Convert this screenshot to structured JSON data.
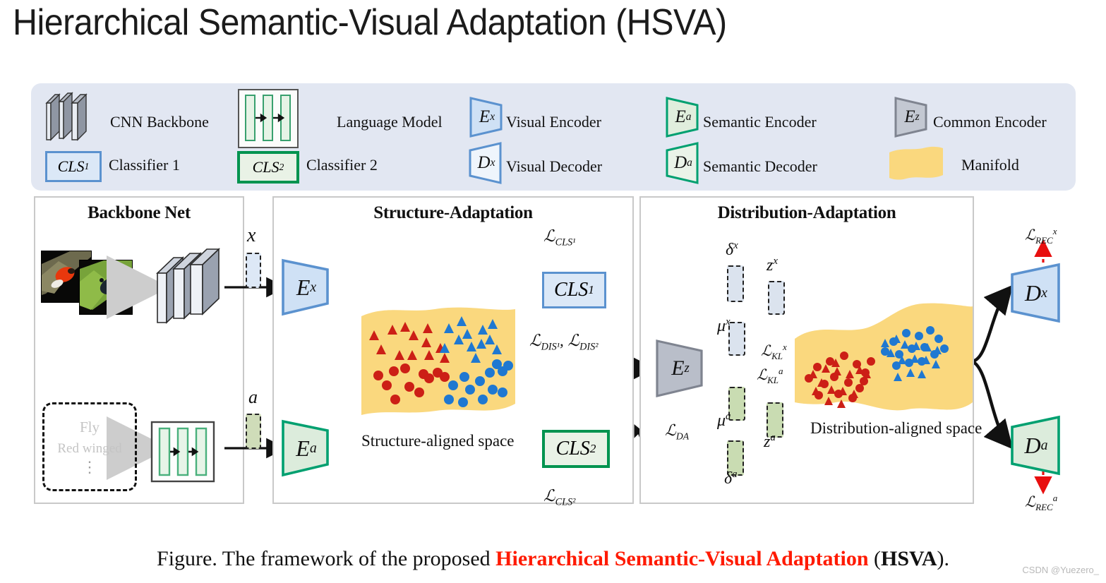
{
  "title": "Hierarchical Semantic-Visual Adaptation (HSVA)",
  "legend": {
    "items": [
      {
        "icon": "cnn-stack-icon",
        "label": "CNN Backbone"
      },
      {
        "icon": "language-model-icon",
        "label": "Language Model"
      },
      {
        "icon": "visual-encoder-icon",
        "symbol": "E",
        "sup": "x",
        "label": "Visual Encoder"
      },
      {
        "icon": "semantic-encoder-icon",
        "symbol": "E",
        "sup": "a",
        "label": "Semantic Encoder"
      },
      {
        "icon": "common-encoder-icon",
        "symbol": "E",
        "sup": "z",
        "label": "Common Encoder"
      },
      {
        "icon": "classifier1-icon",
        "symbol": "CLS",
        "sup": "1",
        "label": "Classifier 1"
      },
      {
        "icon": "classifier2-icon",
        "symbol": "CLS",
        "sup": "2",
        "label": "Classifier 2"
      },
      {
        "icon": "visual-decoder-icon",
        "symbol": "D",
        "sup": "x",
        "label": "Visual Decoder"
      },
      {
        "icon": "semantic-decoder-icon",
        "symbol": "D",
        "sup": "a",
        "label": "Semantic Decoder"
      },
      {
        "icon": "manifold-icon",
        "label": "Manifold"
      }
    ]
  },
  "panels": {
    "backbone": {
      "title": "Backbone Net",
      "attributes": [
        "Fly",
        "Red winged",
        "⋮"
      ]
    },
    "structure": {
      "title": "Structure-Adaptation",
      "space_label": "Structure-aligned space",
      "encoder_visual": {
        "symbol": "E",
        "sup": "x"
      },
      "encoder_semantic": {
        "symbol": "E",
        "sup": "a"
      },
      "classifier1": {
        "symbol": "CLS",
        "sup": "1"
      },
      "classifier2": {
        "symbol": "CLS",
        "sup": "2"
      },
      "feature_x": {
        "symbol": "x"
      },
      "feature_a": {
        "symbol": "a"
      },
      "loss_cls1": {
        "base": "ℒ",
        "sub": "CLS¹"
      },
      "loss_cls2": {
        "base": "ℒ",
        "sub": "CLS²"
      },
      "loss_dis": {
        "base": "ℒ",
        "sub": "DIS¹",
        "base2": "ℒ",
        "sub2": "DIS²"
      }
    },
    "distribution": {
      "title": "Distribution-Adaptation",
      "space_label": "Distribution-aligned space",
      "common_encoder": {
        "symbol": "E",
        "sup": "z"
      },
      "delta_x": {
        "symbol": "δ",
        "sup": "x"
      },
      "mu_x": {
        "symbol": "μ",
        "sup": "x"
      },
      "z_x": {
        "symbol": "z",
        "sup": "x"
      },
      "mu_a": {
        "symbol": "μ",
        "sup": "a"
      },
      "delta_a": {
        "symbol": "δ",
        "sup": "a"
      },
      "z_a": {
        "symbol": "z",
        "sup": "a"
      },
      "loss_da": {
        "base": "ℒ",
        "sub": "DA"
      },
      "loss_kl_x": {
        "base": "ℒ",
        "sub": "KL",
        "sup": "x"
      },
      "loss_kl_a": {
        "base": "ℒ",
        "sub": "KL",
        "sup": "a"
      },
      "decoder_visual": {
        "symbol": "D",
        "sup": "x"
      },
      "decoder_semantic": {
        "symbol": "D",
        "sup": "a"
      },
      "loss_rec_x": {
        "base": "ℒ",
        "sub": "REC",
        "sup": "x"
      },
      "loss_rec_a": {
        "base": "ℒ",
        "sub": "REC",
        "sup": "a"
      }
    }
  },
  "caption": {
    "prefix": "Figure. The framework of the proposed ",
    "highlight": "Hierarchical Semantic-Visual Adaptation",
    "middle": " (",
    "acronym": "HSVA",
    "suffix": ")."
  },
  "watermark": "CSDN @Yuezero_",
  "colors": {
    "legend_bg": "#e2e7f2",
    "blue_fill": "#cfe1f5",
    "blue_stroke": "#5b92cf",
    "green_fill": "#dcecdc",
    "green_stroke": "#00a070",
    "gray_fill": "#b9bec9",
    "gray_stroke": "#7f8490",
    "manifold": "#fad87e",
    "red_point": "#cc1f16",
    "blue_point": "#1f78d1",
    "loss_red": "#e80f0f",
    "caption_red": "#ff1a00"
  },
  "chart_data": {
    "type": "scatter",
    "title": "Structure-aligned space / Distribution-aligned space",
    "panels": [
      {
        "name": "Structure-aligned space",
        "note": "loosely spread points on manifold; red on left, blue on right",
        "series": [
          {
            "name": "red-triangles",
            "marker": "triangle",
            "color": "#cc1f16",
            "count": 16
          },
          {
            "name": "red-circles",
            "marker": "circle",
            "color": "#cc1f16",
            "count": 13
          },
          {
            "name": "blue-triangles",
            "marker": "triangle",
            "color": "#1f78d1",
            "count": 17
          },
          {
            "name": "blue-circles",
            "marker": "circle",
            "color": "#1f78d1",
            "count": 13
          }
        ]
      },
      {
        "name": "Distribution-aligned space",
        "note": "two tight mixed clusters; red cluster left, blue cluster right",
        "series": [
          {
            "name": "red-cluster",
            "marker": "mixed",
            "color": "#cc1f16",
            "count": 34
          },
          {
            "name": "blue-cluster",
            "marker": "mixed",
            "color": "#1f78d1",
            "count": 30
          }
        ]
      }
    ]
  }
}
